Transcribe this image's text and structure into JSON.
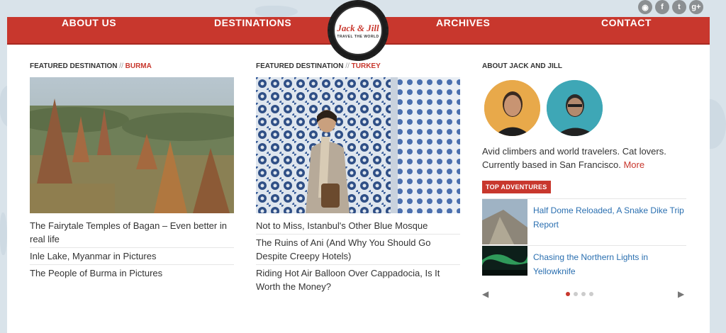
{
  "nav": {
    "about": "ABOUT US",
    "destinations": "DESTINATIONS",
    "archives": "ARCHIVES",
    "contact": "CONTACT"
  },
  "logo": {
    "title": "Jack & Jill",
    "subtitle": "TRAVEL THE WORLD"
  },
  "social": {
    "rss": "rss-icon",
    "facebook": "facebook-icon",
    "twitter": "twitter-icon",
    "googleplus": "google-plus-icon"
  },
  "featured_burma": {
    "label": "FEATURED DESTINATION",
    "sep": "//",
    "place": "BURMA",
    "links": [
      "The Fairytale Temples of Bagan – Even better in real life",
      "Inle Lake, Myanmar in Pictures",
      "The People of Burma in Pictures"
    ]
  },
  "featured_turkey": {
    "label": "FEATURED DESTINATION",
    "sep": "//",
    "place": "TURKEY",
    "links": [
      "Not to Miss, Istanbul's Other Blue Mosque",
      "The Ruins of Ani (And Why You Should Go Despite Creepy Hotels)",
      "Riding Hot Air Balloon Over Cappadocia, Is It Worth the Money?"
    ]
  },
  "about": {
    "title": "ABOUT JACK AND JILL",
    "text": "Avid climbers and world travelers. Cat lovers. Currently based in San Francisco.",
    "more": "More"
  },
  "top_adventures": {
    "badge": "TOP ADVENTURES",
    "items": [
      "Half Dome Reloaded, A Snake Dike Trip Report",
      "Chasing the Northern Lights in Yellowknife"
    ],
    "active_slide": 1,
    "slide_count": 4
  },
  "colors": {
    "accent": "#c8372d",
    "link_blue": "#2a6fb0"
  }
}
